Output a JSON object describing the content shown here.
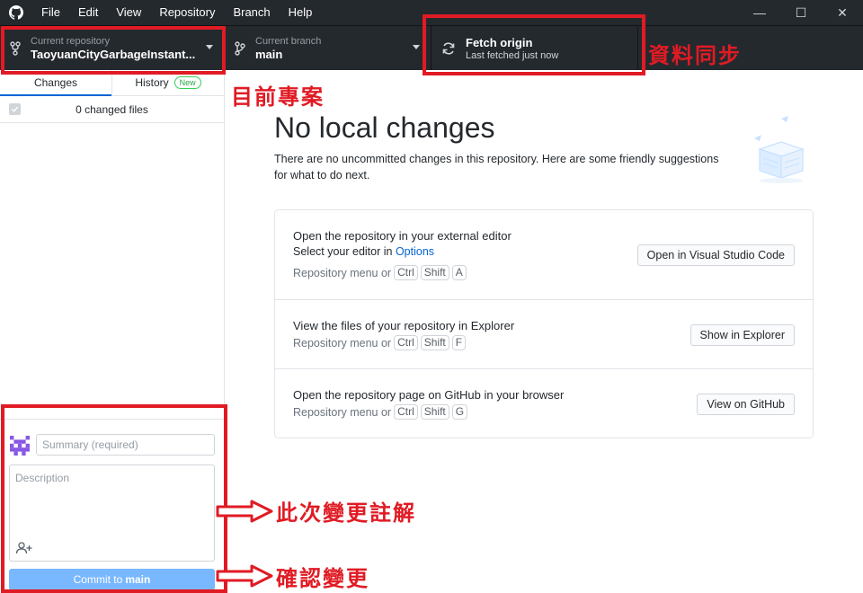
{
  "menu": {
    "items": [
      "File",
      "Edit",
      "View",
      "Repository",
      "Branch",
      "Help"
    ]
  },
  "window_controls": {
    "minimize": "—",
    "maximize": "☐",
    "close": "✕"
  },
  "toolbar": {
    "repo": {
      "label": "Current repository",
      "value": "TaoyuanCityGarbageInstant..."
    },
    "branch": {
      "label": "Current branch",
      "value": "main"
    },
    "fetch": {
      "label": "Fetch origin",
      "sub": "Last fetched just now"
    }
  },
  "sidebar": {
    "tabs": {
      "changes": "Changes",
      "history": "History",
      "new_badge": "New"
    },
    "changed_files": "0 changed files",
    "commit": {
      "summary_placeholder": "Summary (required)",
      "description_placeholder": "Description",
      "button_prefix": "Commit to",
      "button_branch": "main"
    }
  },
  "main": {
    "title": "No local changes",
    "description": "There are no uncommitted changes in this repository. Here are some friendly suggestions for what to do next.",
    "suggestions": [
      {
        "title": "Open the repository in your external editor",
        "sub_prefix": "Select your editor in ",
        "sub_link": "Options",
        "shortcut_prefix": "Repository menu or",
        "keys": [
          "Ctrl",
          "Shift",
          "A"
        ],
        "button": "Open in Visual Studio Code"
      },
      {
        "title": "View the files of your repository in Explorer",
        "shortcut_prefix": "Repository menu or",
        "keys": [
          "Ctrl",
          "Shift",
          "F"
        ],
        "button": "Show in Explorer"
      },
      {
        "title": "Open the repository page on GitHub in your browser",
        "shortcut_prefix": "Repository menu or",
        "keys": [
          "Ctrl",
          "Shift",
          "G"
        ],
        "button": "View on GitHub"
      }
    ]
  },
  "annotations": {
    "sync": "資料同步",
    "project": "目前專案",
    "commit_note": "此次變更註解",
    "confirm": "確認變更",
    "color": "#e01b24"
  },
  "colors": {
    "toolbar_bg": "#24292e",
    "commit_button": "#79b8ff",
    "link": "#0366d6",
    "badge": "#28a745"
  }
}
